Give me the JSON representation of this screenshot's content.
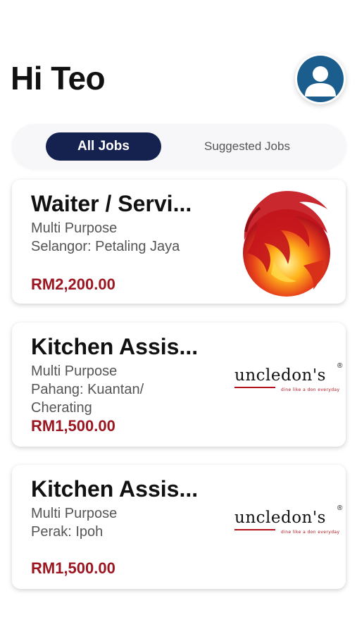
{
  "header": {
    "greeting": "Hi Teo",
    "avatar_icon": "user-icon"
  },
  "tabs": {
    "items": [
      {
        "label": "All Jobs",
        "active": true
      },
      {
        "label": "Suggested Jobs",
        "active": false
      }
    ]
  },
  "jobs": [
    {
      "title": "Waiter / Servi...",
      "category": "Multi Purpose",
      "location": "Selangor: Petaling Jaya",
      "salary": "RM2,200.00",
      "logo": "phoenix-logo"
    },
    {
      "title": "Kitchen Assis...",
      "category": "Multi Purpose",
      "location": "Pahang: Kuantan/ Cherating",
      "salary": "RM1,500.00",
      "logo": "uncledons-logo",
      "logo_text": "uncledon's",
      "logo_tagline": "dine like a don everyday"
    },
    {
      "title": "Kitchen Assis...",
      "category": "Multi Purpose",
      "location": "Perak: Ipoh",
      "salary": "RM1,500.00",
      "logo": "uncledons-logo",
      "logo_text": "uncledon's",
      "logo_tagline": "dine like a don everyday"
    }
  ],
  "colors": {
    "active_tab": "#15214f",
    "salary": "#9b1620",
    "avatar": "#1b5e8e"
  }
}
